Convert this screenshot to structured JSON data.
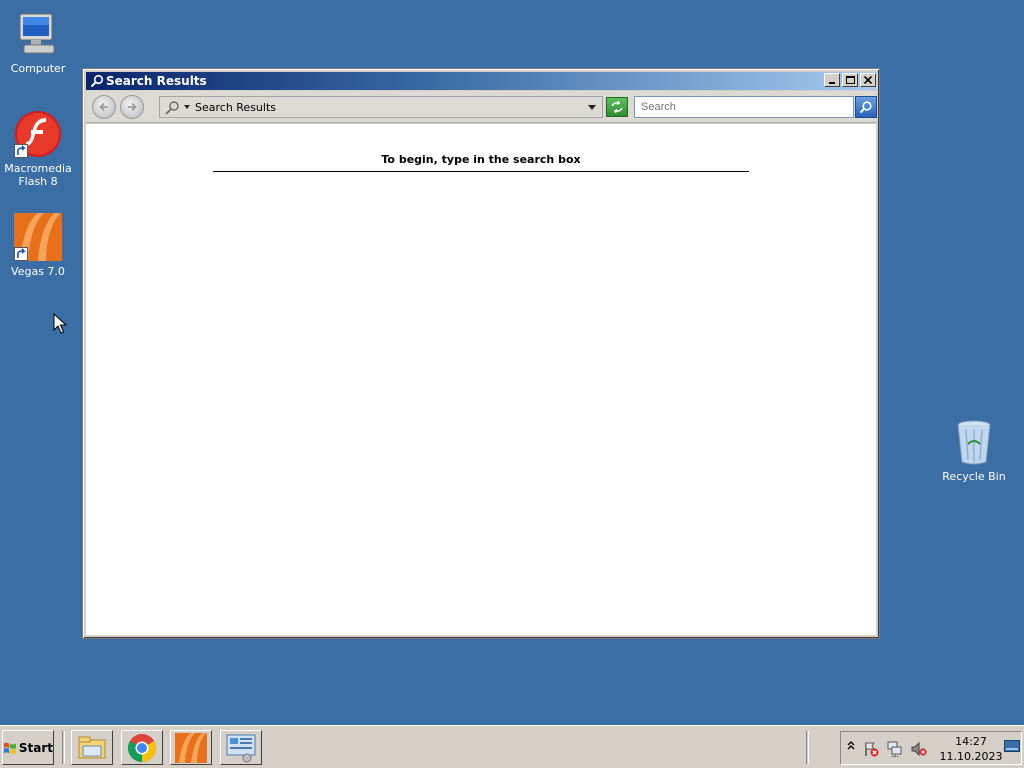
{
  "desktop": {
    "icons": [
      {
        "label": "Computer",
        "icon": "computer-icon"
      },
      {
        "label": "Macromedia Flash 8",
        "icon": "flash-icon"
      },
      {
        "label": "Vegas 7.0",
        "icon": "vegas-icon"
      },
      {
        "label": "Recycle Bin",
        "icon": "recycle-bin-icon"
      }
    ],
    "background_color": "#3a6ea5"
  },
  "window": {
    "title": "Search Results",
    "address": "Search Results",
    "search_placeholder": "Search",
    "hint": "To begin, type in the search box"
  },
  "taskbar": {
    "start_label": "Start",
    "apps": [
      "explorer-icon",
      "chrome-icon",
      "vegas-icon",
      "control-panel-icon"
    ],
    "clock": {
      "time": "14:27",
      "date": "11.10.2023"
    }
  }
}
